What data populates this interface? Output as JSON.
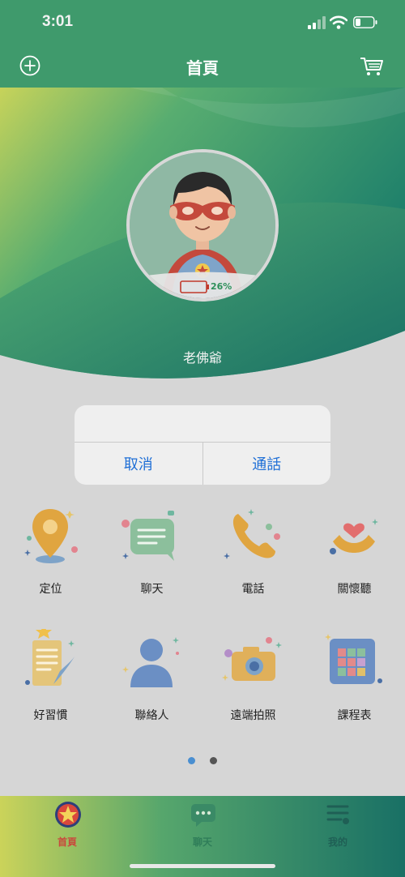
{
  "status_bar": {
    "time": "3:01"
  },
  "header": {
    "title": "首頁",
    "add_icon": "plus-circle-icon",
    "cart_icon": "cart-icon"
  },
  "profile": {
    "name": "老佛爺",
    "battery": "26%",
    "battery_color": "#c0392b"
  },
  "dialog": {
    "cancel_label": "取消",
    "call_label": "通話",
    "accent": "#1f6fd6"
  },
  "features": [
    {
      "label": "定位",
      "icon": "location-pin-icon"
    },
    {
      "label": "聊天",
      "icon": "chat-bubble-icon"
    },
    {
      "label": "電話",
      "icon": "phone-icon"
    },
    {
      "label": "關懷聽",
      "icon": "care-listen-icon"
    },
    {
      "label": "好習慣",
      "icon": "habit-notebook-icon"
    },
    {
      "label": "聯絡人",
      "icon": "contact-person-icon"
    },
    {
      "label": "遠端拍照",
      "icon": "camera-icon"
    },
    {
      "label": "課程表",
      "icon": "schedule-calendar-icon"
    }
  ],
  "pager": {
    "pages": 2,
    "current": 1
  },
  "tabbar": {
    "items": [
      {
        "label": "首頁"
      },
      {
        "label": "聊天"
      },
      {
        "label": "我的"
      }
    ]
  },
  "colors": {
    "brand_green": "#3f9a6c",
    "active_tab": "#c9483c"
  }
}
